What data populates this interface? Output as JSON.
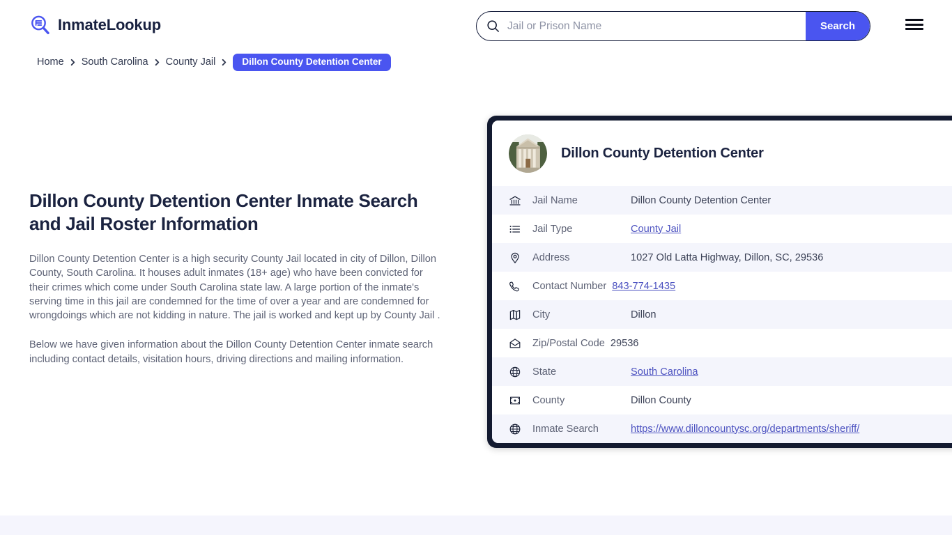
{
  "header": {
    "brand_name": "InmateLookup",
    "logo_icon": "magnifier-list-icon",
    "menu_icon": "hamburger-menu-icon",
    "accent_color": "#4a55f0",
    "dark_color": "#131a30"
  },
  "search": {
    "icon": "search-icon",
    "placeholder": "Jail or Prison Name",
    "value": "",
    "button_label": "Search"
  },
  "breadcrumb": {
    "items": [
      {
        "label": "Home",
        "current": false
      },
      {
        "label": "South Carolina",
        "current": false
      },
      {
        "label": "County Jail",
        "current": false
      },
      {
        "label": "Dillon County Detention Center",
        "current": true
      }
    ]
  },
  "main": {
    "title": "Dillon County Detention Center Inmate Search and Jail Roster Information",
    "paragraphs": [
      "Dillon County Detention Center is a high security County Jail located in city of Dillon, Dillon County, South Carolina. It houses adult inmates (18+ age) who have been convicted for their crimes which come under South Carolina state law. A large portion of the inmate's serving time in this jail are condemned for the time of over a year and are condemned for wrongdoings which are not kidding in nature. The jail is worked and kept up by County Jail .",
      "Below we have given information about the Dillon County Detention Center inmate search including contact details, visitation hours, driving directions and mailing information."
    ]
  },
  "info_card": {
    "avatar_icon": "courthouse-photo",
    "title": "Dillon County Detention Center",
    "rows": [
      {
        "icon": "bank-icon",
        "label": "Jail Name",
        "value": "Dillon County Detention Center",
        "link": false
      },
      {
        "icon": "list-icon",
        "label": "Jail Type",
        "value": "County Jail",
        "link": true
      },
      {
        "icon": "map-pin-icon",
        "label": "Address",
        "value": "1027 Old Latta Highway, Dillon, SC, 29536",
        "link": false
      },
      {
        "icon": "phone-icon",
        "label": "Contact Number",
        "value": "843-774-1435",
        "link": true
      },
      {
        "icon": "map-icon",
        "label": "City",
        "value": "Dillon",
        "link": false
      },
      {
        "icon": "envelope-icon",
        "label": "Zip/Postal Code",
        "value": "29536",
        "link": false
      },
      {
        "icon": "globe-icon",
        "label": "State",
        "value": "South Carolina",
        "link": true
      },
      {
        "icon": "county-pin-icon",
        "label": "County",
        "value": "Dillon County",
        "link": false
      },
      {
        "icon": "web-globe-icon",
        "label": "Inmate Search",
        "value": "https://www.dilloncountysc.org/departments/sheriff/",
        "link": true
      }
    ]
  }
}
